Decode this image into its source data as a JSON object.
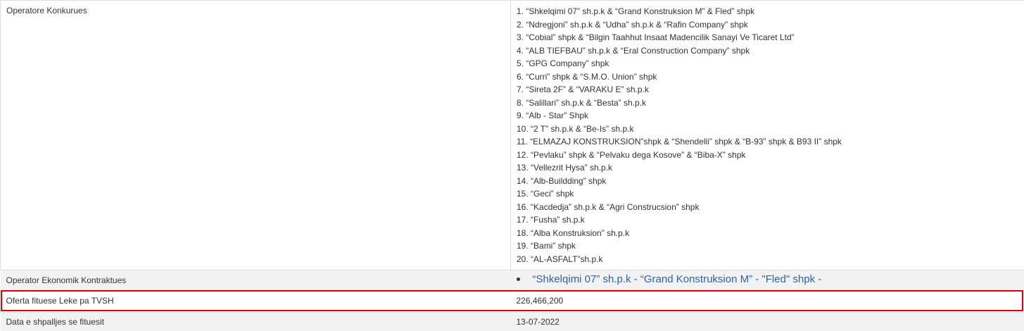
{
  "rows": {
    "operators_label": "Operatore Konkurues",
    "operators": [
      "1. “Shkelqimi 07” sh.p.k & “Grand Konstruksion M” & Fled” shpk",
      "2. “Ndregjoni” sh.p.k & “Udha” sh.p.k & “Rafin Company” shpk",
      "3. “Cobial” shpk & “Bilgin Taahhut Insaat Madencilik Sanayi Ve Ticaret Ltd”",
      "4. “ALB TIEFBAU” sh.p.k & “Eral Construction Company” shpk",
      "5. “GPG Company” shpk",
      "6. “Curri” shpk & “S.M.O. Union” shpk",
      "7. “Sireta 2F” & “VARAKU E” sh.p.k",
      "8. “Salillari” sh.p.k & “Besta” sh.p.k",
      "9. “Alb - Star” Shpk",
      "10. “2 T” sh.p.k & “Be-Is” sh.p.k",
      "11. “ELMAZAJ KONSTRUKSION”shpk & “Shendelli” shpk & “B-93” shpk & B93 II” shpk",
      "12. “Pevlaku” shpk & “Pelvaku dega Kosove” & “Biba-X” shpk",
      "13. “Vellezrit Hysa” sh.p.k",
      "14. “Alb-Buildding” shpk",
      "15. “Geci” shpk",
      "16. “Kacdedja” sh.p.k & “Agri Construcsion” shpk",
      "17. “Fusha” sh.p.k",
      "18. “Alba Konstruksion” sh.p.k",
      "19. “Bami” shpk",
      "20. “AL-ASFALT”sh.p.k"
    ],
    "contract_label": "Operator Ekonomik Kontraktues",
    "contract_value": "“Shkelqimi 07” sh.p.k - “Grand Konstruksion M” - \"Fled\" shpk -",
    "offer_label": "Oferta fituese Leke pa TVSH",
    "offer_value": "226,466,200",
    "date_label": "Data e shpalljes se fituesit",
    "date_value": "13-07-2022"
  },
  "colors": {
    "link": "#2a64ad",
    "highlight_border": "#e00000",
    "stripe": "#f2f2f2"
  }
}
